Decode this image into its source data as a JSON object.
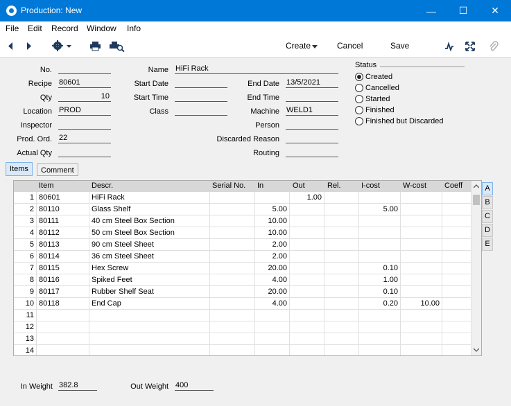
{
  "window": {
    "title": "Production: New"
  },
  "menu": [
    "File",
    "Edit",
    "Record",
    "Window",
    "Info"
  ],
  "toolbar": {
    "create": "Create",
    "cancel": "Cancel",
    "save": "Save"
  },
  "header": {
    "no": {
      "label": "No.",
      "value": ""
    },
    "recipe": {
      "label": "Recipe",
      "value": "80601"
    },
    "qty": {
      "label": "Qty",
      "value": "10"
    },
    "location": {
      "label": "Location",
      "value": "PROD"
    },
    "inspector": {
      "label": "Inspector",
      "value": ""
    },
    "prod_ord": {
      "label": "Prod. Ord.",
      "value": "22"
    },
    "actual_qty": {
      "label": "Actual Qty",
      "value": ""
    },
    "name": {
      "label": "Name",
      "value": "HiFi Rack"
    },
    "start_date": {
      "label": "Start Date",
      "value": ""
    },
    "start_time": {
      "label": "Start Time",
      "value": ""
    },
    "class": {
      "label": "Class",
      "value": ""
    },
    "end_date": {
      "label": "End Date",
      "value": "13/5/2021"
    },
    "end_time": {
      "label": "End Time",
      "value": ""
    },
    "machine": {
      "label": "Machine",
      "value": "WELD1"
    },
    "person": {
      "label": "Person",
      "value": ""
    },
    "discarded_reason": {
      "label": "Discarded Reason",
      "value": ""
    },
    "routing": {
      "label": "Routing",
      "value": ""
    }
  },
  "status": {
    "label": "Status",
    "options": [
      "Created",
      "Cancelled",
      "Started",
      "Finished",
      "Finished but Discarded"
    ],
    "selected": "Created"
  },
  "tabs": [
    "Items",
    "Comment"
  ],
  "grid": {
    "columns": [
      "Item",
      "Descr.",
      "Serial No.",
      "In",
      "Out",
      "Rel.",
      "I-cost",
      "W-cost",
      "Coeff"
    ],
    "rows": [
      {
        "n": "1",
        "item": "80601",
        "descr": "HiFi Rack",
        "serial": "",
        "in": "",
        "out": "1.00",
        "rel": "",
        "icost": "",
        "wcost": "",
        "coeff": ""
      },
      {
        "n": "2",
        "item": "80110",
        "descr": "Glass Shelf",
        "serial": "",
        "in": "5.00",
        "out": "",
        "rel": "",
        "icost": "5.00",
        "wcost": "",
        "coeff": ""
      },
      {
        "n": "3",
        "item": "80111",
        "descr": "40 cm Steel Box Section",
        "serial": "",
        "in": "10.00",
        "out": "",
        "rel": "",
        "icost": "",
        "wcost": "",
        "coeff": ""
      },
      {
        "n": "4",
        "item": "80112",
        "descr": "50 cm Steel Box Section",
        "serial": "",
        "in": "10.00",
        "out": "",
        "rel": "",
        "icost": "",
        "wcost": "",
        "coeff": ""
      },
      {
        "n": "5",
        "item": "80113",
        "descr": "90 cm Steel Sheet",
        "serial": "",
        "in": "2.00",
        "out": "",
        "rel": "",
        "icost": "",
        "wcost": "",
        "coeff": ""
      },
      {
        "n": "6",
        "item": "80114",
        "descr": "36 cm Steel Sheet",
        "serial": "",
        "in": "2.00",
        "out": "",
        "rel": "",
        "icost": "",
        "wcost": "",
        "coeff": ""
      },
      {
        "n": "7",
        "item": "80115",
        "descr": "Hex Screw",
        "serial": "",
        "in": "20.00",
        "out": "",
        "rel": "",
        "icost": "0.10",
        "wcost": "",
        "coeff": ""
      },
      {
        "n": "8",
        "item": "80116",
        "descr": "Spiked Feet",
        "serial": "",
        "in": "4.00",
        "out": "",
        "rel": "",
        "icost": "1.00",
        "wcost": "",
        "coeff": ""
      },
      {
        "n": "9",
        "item": "80117",
        "descr": "Rubber Shelf Seat",
        "serial": "",
        "in": "20.00",
        "out": "",
        "rel": "",
        "icost": "0.10",
        "wcost": "",
        "coeff": ""
      },
      {
        "n": "10",
        "item": "80118",
        "descr": "End Cap",
        "serial": "",
        "in": "4.00",
        "out": "",
        "rel": "",
        "icost": "0.20",
        "wcost": "10.00",
        "coeff": ""
      },
      {
        "n": "11",
        "item": "",
        "descr": "",
        "serial": "",
        "in": "",
        "out": "",
        "rel": "",
        "icost": "",
        "wcost": "",
        "coeff": ""
      },
      {
        "n": "12",
        "item": "",
        "descr": "",
        "serial": "",
        "in": "",
        "out": "",
        "rel": "",
        "icost": "",
        "wcost": "",
        "coeff": ""
      },
      {
        "n": "13",
        "item": "",
        "descr": "",
        "serial": "",
        "in": "",
        "out": "",
        "rel": "",
        "icost": "",
        "wcost": "",
        "coeff": ""
      },
      {
        "n": "14",
        "item": "",
        "descr": "",
        "serial": "",
        "in": "",
        "out": "",
        "rel": "",
        "icost": "",
        "wcost": "",
        "coeff": ""
      }
    ]
  },
  "card_tabs": [
    "A",
    "B",
    "C",
    "D",
    "E"
  ],
  "footer": {
    "in_weight": {
      "label": "In Weight",
      "value": "382.8"
    },
    "out_weight": {
      "label": "Out Weight",
      "value": "400"
    }
  }
}
